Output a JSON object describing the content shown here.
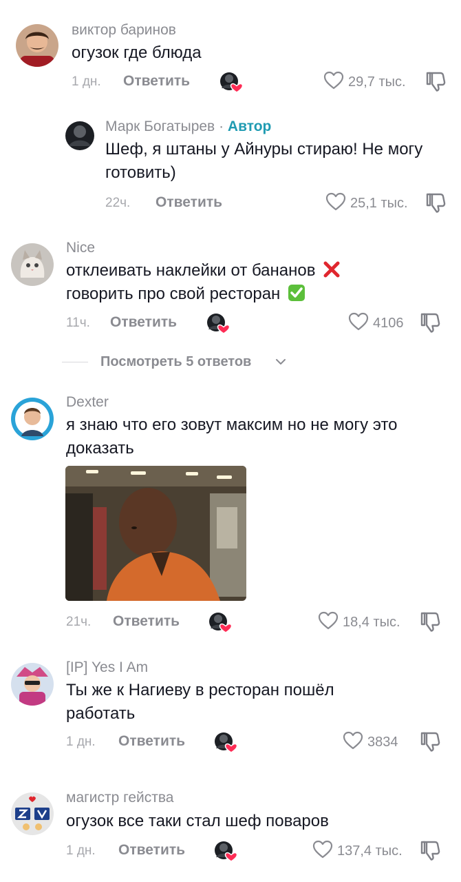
{
  "reply_label": "Ответить",
  "view_more": "Посмотреть 5 ответов",
  "comments": [
    {
      "author": "виктор баринов",
      "text": "огузок где блюда",
      "time": "1 дн.",
      "likes": "29,7 тыс."
    },
    {
      "author": "Марк Богатырев",
      "author_sep": "·",
      "badge": "Автор",
      "text": "Шеф, я штаны у Айнуры стираю! Не могу готовить)",
      "time": "22ч.",
      "likes": "25,1 тыс."
    },
    {
      "author": "Nice",
      "text_line1": "отклеивать наклейки от бананов",
      "text_line2": "говорить про свой ресторан",
      "emoji1": "cross-mark",
      "emoji2": "check-mark",
      "time": "11ч.",
      "likes": "4106"
    },
    {
      "author": "Dexter",
      "text": "я знаю что его зовут максим но не могу это доказать",
      "time": "21ч.",
      "likes": "18,4 тыс."
    },
    {
      "author": "[IP] Yes I Am",
      "text": "Ты же к Нагиеву в ресторан пошёл работать",
      "time": "1 дн.",
      "likes": "3834"
    },
    {
      "author": "магистр гейства",
      "text": "огузок все таки стал шеф поваров",
      "time": "1 дн.",
      "likes": "137,4 тыс."
    }
  ],
  "icons": {
    "heart": "heart-outline-icon",
    "dislike": "thumbs-down-icon",
    "creator_liked": "creator-liked-avatar-icon",
    "chevron": "chevron-down-icon"
  },
  "colors": {
    "author_badge": "#1f9bb2",
    "secondary_text": "#8a8b91",
    "heart_badge": "#fe2c55"
  }
}
